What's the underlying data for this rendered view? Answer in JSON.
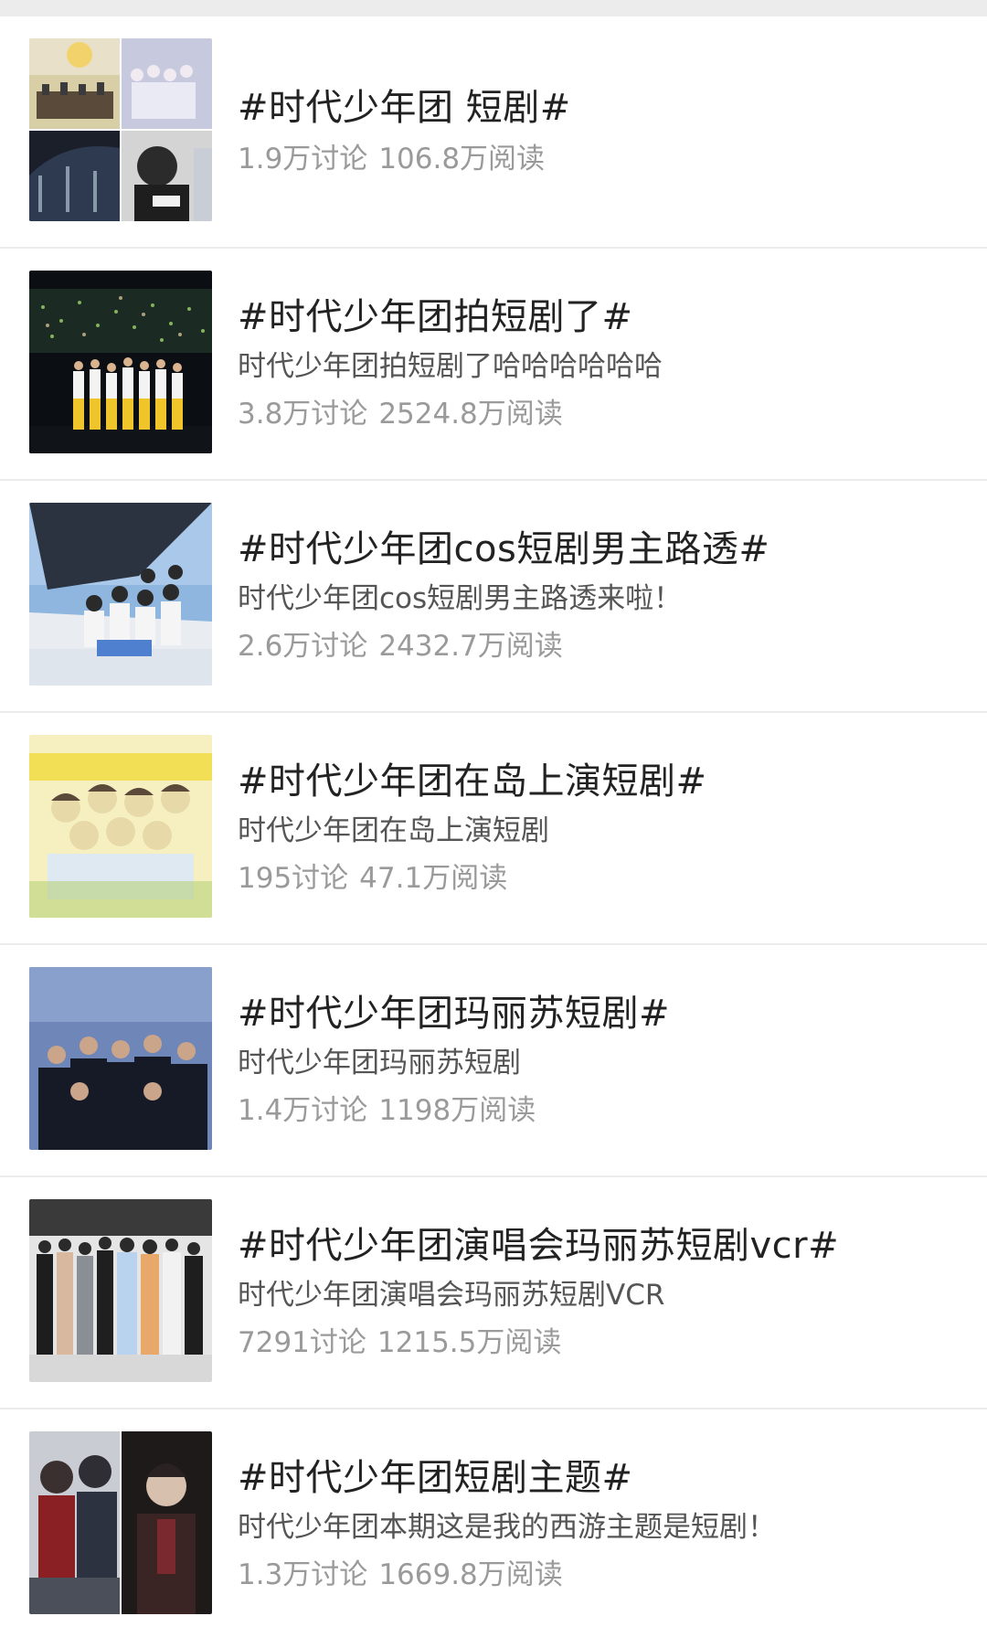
{
  "topics": [
    {
      "title": "#时代少年团 短剧#",
      "desc": "",
      "discussions": "1.9万讨论",
      "reads": "106.8万阅读",
      "thumbnail": "collage-group-photos"
    },
    {
      "title": "#时代少年团拍短剧了#",
      "desc": "时代少年团拍短剧了哈哈哈哈哈哈",
      "discussions": "3.8万讨论",
      "reads": "2524.8万阅读",
      "thumbnail": "concert-stage-photo"
    },
    {
      "title": "#时代少年团cos短剧男主路透#",
      "desc": "时代少年团cos短剧男主路透来啦！",
      "discussions": "2.6万讨论",
      "reads": "2432.7万阅读",
      "thumbnail": "group-on-boat-photo"
    },
    {
      "title": "#时代少年团在岛上演短剧#",
      "desc": "时代少年团在岛上演短剧",
      "discussions": "195讨论",
      "reads": "47.1万阅读",
      "thumbnail": "teens-poster"
    },
    {
      "title": "#时代少年团玛丽苏短剧#",
      "desc": "时代少年团玛丽苏短剧",
      "discussions": "1.4万讨论",
      "reads": "1198万阅读",
      "thumbnail": "group-dark-outfits-photo"
    },
    {
      "title": "#时代少年团演唱会玛丽苏短剧vcr#",
      "desc": "时代少年团演唱会玛丽苏短剧VCR",
      "discussions": "7291讨论",
      "reads": "1215.5万阅读",
      "thumbnail": "group-standing-photo"
    },
    {
      "title": "#时代少年团短剧主题#",
      "desc": "时代少年团本期这是我的西游主题是短剧！",
      "discussions": "1.3万讨论",
      "reads": "1669.8万阅读",
      "thumbnail": "portrait-collage"
    }
  ],
  "colors": {
    "title": "#222222",
    "desc": "#555555",
    "meta": "#9a9a9a",
    "divider": "#ebebeb",
    "top_bar": "#ececec"
  }
}
